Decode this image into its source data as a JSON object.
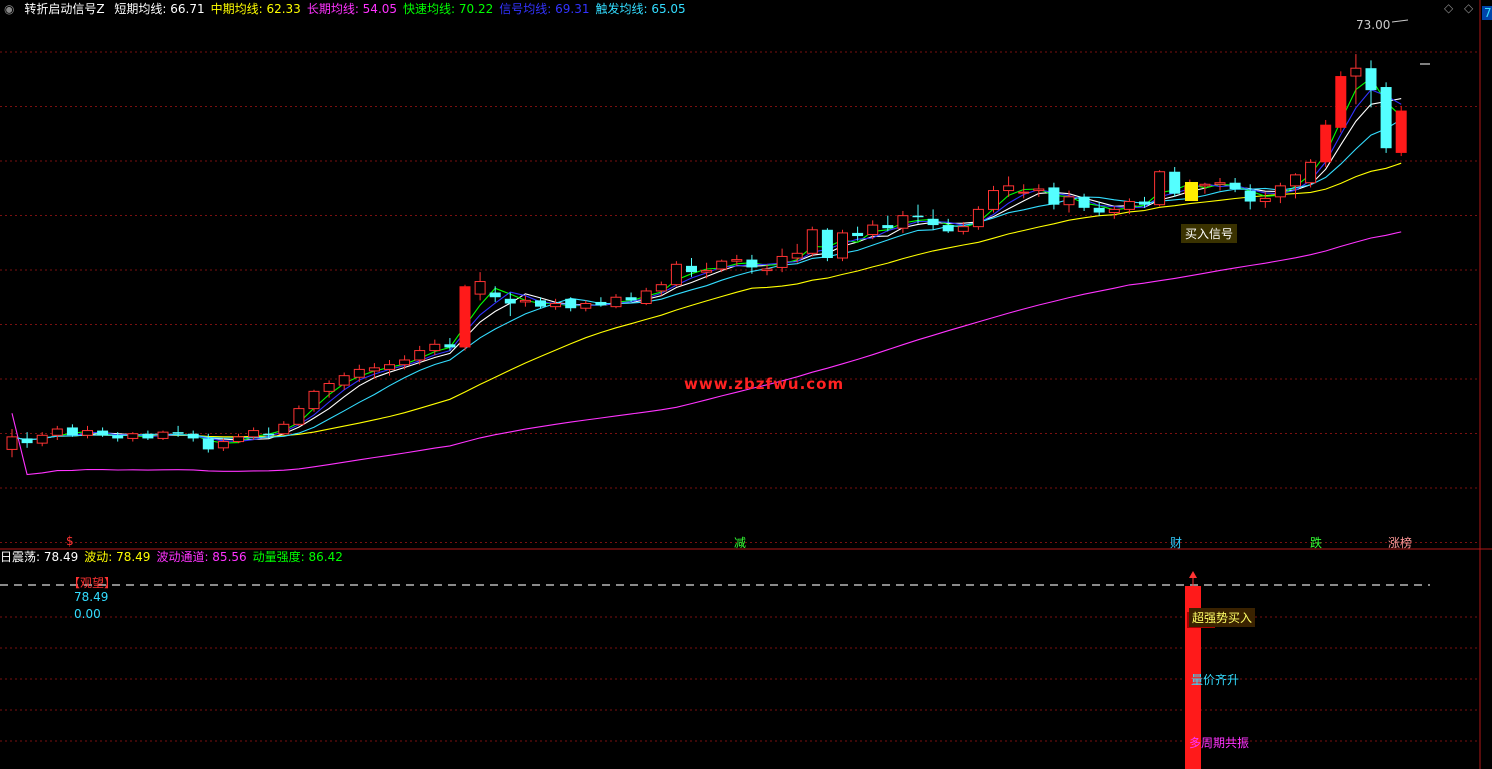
{
  "header": {
    "indicator_name": "转折启动信号Z",
    "ma_items": [
      {
        "label": "短期均线:",
        "value": "66.71",
        "color": "#ffffff"
      },
      {
        "label": "中期均线:",
        "value": "62.33",
        "color": "#ffff00"
      },
      {
        "label": "长期均线:",
        "value": "54.05",
        "color": "#ff33ff"
      },
      {
        "label": "快速均线:",
        "value": "70.22",
        "color": "#00ff00"
      },
      {
        "label": "信号均线:",
        "value": "69.31",
        "color": "#3333ff"
      },
      {
        "label": "触发均线:",
        "value": "65.05",
        "color": "#33ddff"
      }
    ],
    "right_marker": "7"
  },
  "sub_header": {
    "items": [
      {
        "label": "日震荡:",
        "value": "78.49",
        "color": "#ffffff"
      },
      {
        "label": "波动:",
        "value": "78.49",
        "color": "#ffff00"
      },
      {
        "label": "波动通道:",
        "value": "85.56",
        "color": "#ff33ff"
      },
      {
        "label": "动量强度:",
        "value": "86.42",
        "color": "#00ff00"
      }
    ]
  },
  "sub_panel": {
    "bracket_label": "【观望】",
    "value_a": "78.49",
    "value_b": "0.00",
    "signal_strong": "超强势买入",
    "signal_volume": "量价齐升",
    "signal_resonance": "多周期共振"
  },
  "annotations": {
    "high_price": "73.00",
    "buy_signal": "买入信号",
    "watermark": "www.zbzfwu.com",
    "bottom_markers": [
      {
        "text": "$",
        "color": "#ff3333"
      },
      {
        "text": "减",
        "color": "#33ff33"
      },
      {
        "text": "财",
        "color": "#33ccff"
      },
      {
        "text": "跌",
        "color": "#33ff33"
      },
      {
        "text": "涨榜",
        "color": "#ff9999"
      }
    ]
  },
  "chart_data": {
    "type": "candlestick",
    "n": 94,
    "ylim": [
      43,
      75
    ],
    "candles": [
      {
        "o": 47.5,
        "h": 48.8,
        "l": 47.0,
        "c": 48.3
      },
      {
        "o": 48.2,
        "h": 48.6,
        "l": 47.6,
        "c": 47.9
      },
      {
        "o": 47.9,
        "h": 48.6,
        "l": 47.7,
        "c": 48.4
      },
      {
        "o": 48.4,
        "h": 49.0,
        "l": 48.1,
        "c": 48.8
      },
      {
        "o": 48.9,
        "h": 49.1,
        "l": 48.3,
        "c": 48.4
      },
      {
        "o": 48.4,
        "h": 49.0,
        "l": 48.2,
        "c": 48.7
      },
      {
        "o": 48.7,
        "h": 48.9,
        "l": 48.3,
        "c": 48.4
      },
      {
        "o": 48.4,
        "h": 48.6,
        "l": 48.0,
        "c": 48.2
      },
      {
        "o": 48.2,
        "h": 48.6,
        "l": 48.0,
        "c": 48.5
      },
      {
        "o": 48.5,
        "h": 48.7,
        "l": 48.1,
        "c": 48.2
      },
      {
        "o": 48.2,
        "h": 48.7,
        "l": 48.1,
        "c": 48.6
      },
      {
        "o": 48.6,
        "h": 49.0,
        "l": 48.3,
        "c": 48.5
      },
      {
        "o": 48.5,
        "h": 48.7,
        "l": 48.0,
        "c": 48.2
      },
      {
        "o": 48.2,
        "h": 48.5,
        "l": 47.3,
        "c": 47.5
      },
      {
        "o": 47.6,
        "h": 48.2,
        "l": 47.4,
        "c": 48.0
      },
      {
        "o": 48.0,
        "h": 48.5,
        "l": 47.9,
        "c": 48.3
      },
      {
        "o": 48.3,
        "h": 48.9,
        "l": 48.1,
        "c": 48.7
      },
      {
        "o": 48.5,
        "h": 48.9,
        "l": 48.2,
        "c": 48.4
      },
      {
        "o": 48.5,
        "h": 49.3,
        "l": 48.4,
        "c": 49.1
      },
      {
        "o": 49.1,
        "h": 50.3,
        "l": 49.0,
        "c": 50.1
      },
      {
        "o": 50.1,
        "h": 51.3,
        "l": 49.9,
        "c": 51.2
      },
      {
        "o": 51.2,
        "h": 51.9,
        "l": 50.8,
        "c": 51.7
      },
      {
        "o": 51.6,
        "h": 52.4,
        "l": 51.3,
        "c": 52.2
      },
      {
        "o": 52.1,
        "h": 52.9,
        "l": 51.8,
        "c": 52.6
      },
      {
        "o": 52.5,
        "h": 53.0,
        "l": 52.0,
        "c": 52.7
      },
      {
        "o": 52.6,
        "h": 53.2,
        "l": 52.2,
        "c": 52.9
      },
      {
        "o": 52.9,
        "h": 53.5,
        "l": 52.6,
        "c": 53.2
      },
      {
        "o": 53.2,
        "h": 54.1,
        "l": 52.9,
        "c": 53.8
      },
      {
        "o": 53.8,
        "h": 54.5,
        "l": 53.5,
        "c": 54.2
      },
      {
        "o": 54.2,
        "h": 54.6,
        "l": 53.8,
        "c": 54.0
      },
      {
        "o": 54.0,
        "h": 58.0,
        "l": 53.8,
        "c": 57.9
      },
      {
        "o": 57.4,
        "h": 58.8,
        "l": 57.0,
        "c": 58.2
      },
      {
        "o": 57.5,
        "h": 57.9,
        "l": 56.9,
        "c": 57.2
      },
      {
        "o": 57.1,
        "h": 57.5,
        "l": 56.0,
        "c": 56.8
      },
      {
        "o": 56.9,
        "h": 57.3,
        "l": 56.6,
        "c": 57.0
      },
      {
        "o": 57.0,
        "h": 57.2,
        "l": 56.5,
        "c": 56.6
      },
      {
        "o": 56.6,
        "h": 57.1,
        "l": 56.4,
        "c": 56.8
      },
      {
        "o": 57.1,
        "h": 57.2,
        "l": 56.3,
        "c": 56.5
      },
      {
        "o": 56.5,
        "h": 57.0,
        "l": 56.3,
        "c": 56.8
      },
      {
        "o": 56.9,
        "h": 57.2,
        "l": 56.6,
        "c": 56.7
      },
      {
        "o": 56.6,
        "h": 57.4,
        "l": 56.5,
        "c": 57.2
      },
      {
        "o": 57.2,
        "h": 57.5,
        "l": 56.9,
        "c": 57.0
      },
      {
        "o": 56.8,
        "h": 57.8,
        "l": 56.7,
        "c": 57.6
      },
      {
        "o": 57.6,
        "h": 58.2,
        "l": 57.3,
        "c": 58.0
      },
      {
        "o": 58.0,
        "h": 59.5,
        "l": 57.9,
        "c": 59.3
      },
      {
        "o": 59.2,
        "h": 59.7,
        "l": 58.5,
        "c": 58.8
      },
      {
        "o": 58.8,
        "h": 59.4,
        "l": 58.4,
        "c": 58.9
      },
      {
        "o": 59.0,
        "h": 59.6,
        "l": 58.8,
        "c": 59.5
      },
      {
        "o": 59.5,
        "h": 59.9,
        "l": 59.2,
        "c": 59.6
      },
      {
        "o": 59.6,
        "h": 59.9,
        "l": 58.7,
        "c": 59.1
      },
      {
        "o": 58.9,
        "h": 59.3,
        "l": 58.6,
        "c": 59.0
      },
      {
        "o": 59.1,
        "h": 60.3,
        "l": 58.8,
        "c": 59.8
      },
      {
        "o": 59.7,
        "h": 60.6,
        "l": 59.4,
        "c": 60.0
      },
      {
        "o": 60.0,
        "h": 61.7,
        "l": 59.8,
        "c": 61.5
      },
      {
        "o": 61.5,
        "h": 61.6,
        "l": 59.5,
        "c": 59.7
      },
      {
        "o": 59.7,
        "h": 61.5,
        "l": 59.5,
        "c": 61.3
      },
      {
        "o": 61.3,
        "h": 61.7,
        "l": 60.8,
        "c": 61.1
      },
      {
        "o": 61.2,
        "h": 62.1,
        "l": 60.9,
        "c": 61.8
      },
      {
        "o": 61.8,
        "h": 62.4,
        "l": 61.4,
        "c": 61.6
      },
      {
        "o": 61.6,
        "h": 62.7,
        "l": 61.3,
        "c": 62.4
      },
      {
        "o": 62.4,
        "h": 63.1,
        "l": 61.9,
        "c": 62.3
      },
      {
        "o": 62.2,
        "h": 62.8,
        "l": 61.5,
        "c": 61.8
      },
      {
        "o": 61.8,
        "h": 62.2,
        "l": 61.3,
        "c": 61.4
      },
      {
        "o": 61.4,
        "h": 62.0,
        "l": 61.2,
        "c": 61.7
      },
      {
        "o": 61.7,
        "h": 63.0,
        "l": 61.5,
        "c": 62.8
      },
      {
        "o": 62.8,
        "h": 64.3,
        "l": 62.6,
        "c": 64.0
      },
      {
        "o": 64.0,
        "h": 64.9,
        "l": 63.6,
        "c": 64.3
      },
      {
        "o": 63.9,
        "h": 64.4,
        "l": 63.5,
        "c": 63.9
      },
      {
        "o": 64.0,
        "h": 64.4,
        "l": 63.6,
        "c": 64.1
      },
      {
        "o": 64.2,
        "h": 64.5,
        "l": 62.8,
        "c": 63.1
      },
      {
        "o": 63.1,
        "h": 64.0,
        "l": 62.6,
        "c": 63.6
      },
      {
        "o": 63.6,
        "h": 63.8,
        "l": 62.7,
        "c": 62.9
      },
      {
        "o": 62.9,
        "h": 63.3,
        "l": 62.4,
        "c": 62.6
      },
      {
        "o": 62.6,
        "h": 63.0,
        "l": 62.2,
        "c": 62.8
      },
      {
        "o": 62.8,
        "h": 63.5,
        "l": 62.5,
        "c": 63.3
      },
      {
        "o": 63.3,
        "h": 63.6,
        "l": 62.9,
        "c": 63.1
      },
      {
        "o": 63.1,
        "h": 65.3,
        "l": 63.0,
        "c": 65.2
      },
      {
        "o": 65.2,
        "h": 65.5,
        "l": 63.6,
        "c": 63.8
      },
      {
        "o": 63.8,
        "h": 64.7,
        "l": 63.5,
        "c": 64.3
      },
      {
        "o": 64.3,
        "h": 64.5,
        "l": 63.8,
        "c": 64.4
      },
      {
        "o": 64.4,
        "h": 64.8,
        "l": 64.0,
        "c": 64.5
      },
      {
        "o": 64.5,
        "h": 64.8,
        "l": 63.9,
        "c": 64.1
      },
      {
        "o": 64.0,
        "h": 64.4,
        "l": 62.8,
        "c": 63.3
      },
      {
        "o": 63.3,
        "h": 63.9,
        "l": 62.9,
        "c": 63.5
      },
      {
        "o": 63.6,
        "h": 64.5,
        "l": 63.2,
        "c": 64.3
      },
      {
        "o": 64.3,
        "h": 65.1,
        "l": 63.5,
        "c": 65.0
      },
      {
        "o": 64.5,
        "h": 66.0,
        "l": 64.2,
        "c": 65.8
      },
      {
        "o": 65.8,
        "h": 68.5,
        "l": 65.5,
        "c": 68.2
      },
      {
        "o": 68.0,
        "h": 71.6,
        "l": 67.7,
        "c": 71.3
      },
      {
        "o": 71.3,
        "h": 72.7,
        "l": 69.5,
        "c": 71.8
      },
      {
        "o": 71.8,
        "h": 72.3,
        "l": 69.3,
        "c": 70.4
      },
      {
        "o": 70.6,
        "h": 70.9,
        "l": 66.4,
        "c": 66.7
      },
      {
        "o": 66.4,
        "h": 69.4,
        "l": 66.2,
        "c": 69.1
      }
    ],
    "overlay_series": [
      {
        "name": "短期均线",
        "color": "#ffffff"
      },
      {
        "name": "中期均线",
        "color": "#ffff00"
      },
      {
        "name": "长期均线",
        "color": "#ff33ff"
      },
      {
        "name": "快速均线",
        "color": "#00ff00"
      },
      {
        "name": "信号均线",
        "color": "#3333ff"
      },
      {
        "name": "触发均线",
        "color": "#33ddff"
      }
    ],
    "grid": true
  }
}
